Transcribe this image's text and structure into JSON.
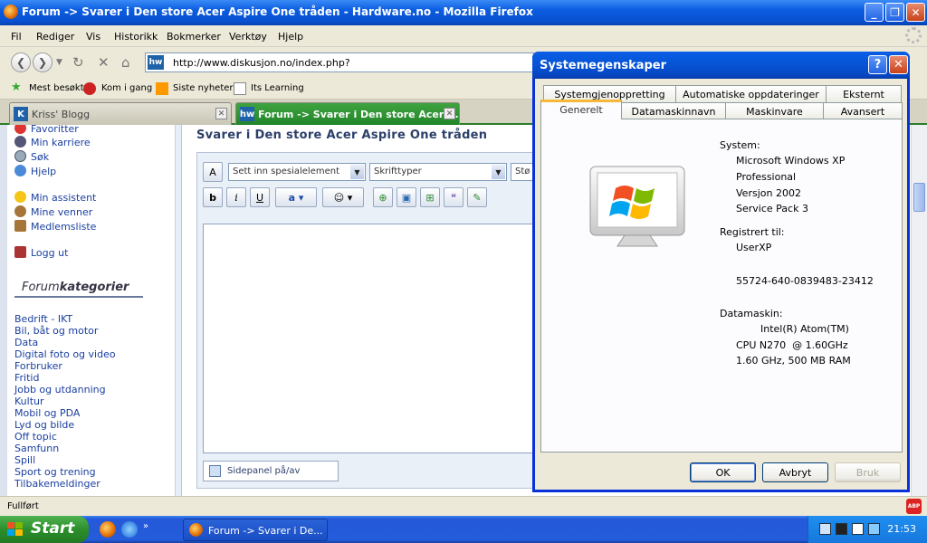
{
  "browser": {
    "window_title": "Forum -> Svarer i Den store Acer Aspire One tråden - Hardware.no - Mozilla Firefox",
    "menu": [
      "Fil",
      "Rediger",
      "Vis",
      "Historikk",
      "Bokmerker",
      "Verktøy",
      "Hjelp"
    ],
    "url": "http://www.diskusjon.no/index.php?",
    "bookmarks": [
      "Mest besøkt",
      "Kom i gang",
      "Siste nyheter",
      "Its Learning"
    ],
    "tabs": [
      {
        "label": "Kriss' Blogg",
        "active": false
      },
      {
        "label": "Forum -> Svarer i Den store Acer ...",
        "active": true
      }
    ],
    "status": "Fullført"
  },
  "page": {
    "left_menu": [
      "Favoritter",
      "Min karriere",
      "Søk",
      "Hjelp",
      "Min assistent",
      "Mine venner",
      "Medlemsliste",
      "Logg ut"
    ],
    "forum_categories_title": {
      "prefix": "Forum",
      "suffix": "kategorier"
    },
    "categories": [
      "Bedrift - IKT",
      "Bil, båt og motor",
      "Data",
      "Digital foto og video",
      "Forbruker",
      "Fritid",
      "Jobb og utdanning",
      "Kultur",
      "Mobil og PDA",
      "Lyd og bilde",
      "Off topic",
      "Samfunn",
      "Spill",
      "Sport og trening",
      "Tilbakemeldinger"
    ],
    "thread_title": "Svarer i Den store Acer Aspire One tråden",
    "editor": {
      "special_elements": "Sett inn spesialelement",
      "fonts": "Skrifttyper",
      "size_partial": "Stø",
      "sidepanel_label": "Sidepanel på/av"
    }
  },
  "dialog": {
    "title": "Systemegenskaper",
    "tabs_row1": [
      "Systemgjenoppretting",
      "Automatiske oppdateringer",
      "Eksternt"
    ],
    "tabs_row2": [
      "Generelt",
      "Datamaskinnavn",
      "Maskinvare",
      "Avansert"
    ],
    "selected_tab": "Generelt",
    "system_label": "System:",
    "system_lines": [
      "Microsoft Windows XP",
      "Professional",
      "Versjon 2002",
      "Service Pack 3"
    ],
    "registered_label": "Registrert til:",
    "registered_user": "UserXP",
    "product_id": "55724-640-0839483-23412",
    "computer_label": "Datamaskin:",
    "computer_lines": [
      "Intel(R) Atom(TM)",
      "CPU N270  @ 1.60GHz",
      "1.60 GHz, 500 MB RAM"
    ],
    "buttons": {
      "ok": "OK",
      "cancel": "Avbryt",
      "apply": "Bruk"
    }
  },
  "taskbar": {
    "start": "Start",
    "task_label": "Forum -> Svarer i De...",
    "clock": "21:53"
  }
}
